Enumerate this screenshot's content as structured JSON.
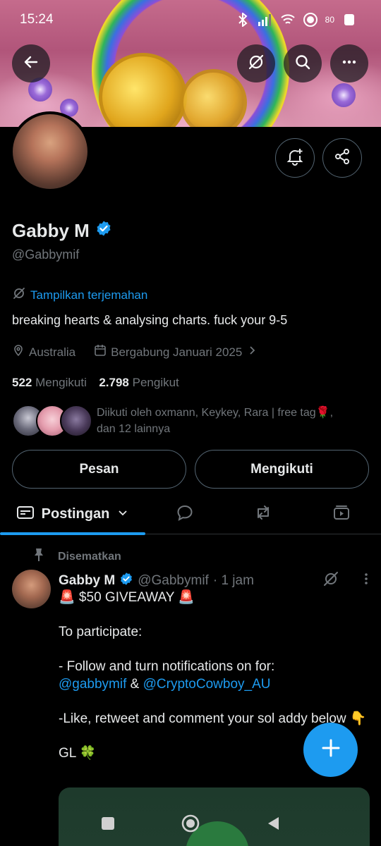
{
  "status_bar": {
    "time": "15:24",
    "battery": "80"
  },
  "colors": {
    "accent": "#1d9bf0",
    "muted": "#71767b",
    "text": "#e7e9ea",
    "border": "#536471",
    "background": "#000000"
  },
  "profile": {
    "name": "Gabby M",
    "handle": "@Gabbymif",
    "translate_label": "Tampilkan terjemahan",
    "bio": "breaking hearts & analysing charts. fuck your 9-5",
    "location": "Australia",
    "joined": "Bergabung Januari 2025",
    "following_count": "522",
    "following_label": "Mengikuti",
    "followers_count": "2.798",
    "followers_label": "Pengikut",
    "followed_by_line1": "Diikuti oleh oxmann, Keykey, Rara | free tag🌹,",
    "followed_by_line2": "dan 12 lainnya"
  },
  "actions": {
    "message_label": "Pesan",
    "following_label": "Mengikuti"
  },
  "tabs": {
    "posts_label": "Postingan"
  },
  "post": {
    "pinned_label": "Disematkan",
    "author_name": "Gabby M",
    "author_handle": "@Gabbymif",
    "time": "· 1 jam",
    "line1": "🚨 $50 GIVEAWAY 🚨",
    "line2": "To participate:",
    "line3": "- Follow and turn notifications on for:",
    "mention1": "@gabbymif",
    "amp": " & ",
    "mention2": "@CryptoCowboy_AU",
    "line5": "-Like, retweet and comment your sol addy below 👇",
    "line6": "GL 🍀"
  },
  "icons": [
    "back-arrow-icon",
    "translate-icon",
    "search-icon",
    "more-icon",
    "bell-plus-icon",
    "share-icon",
    "verified-badge-icon",
    "location-pin-icon",
    "calendar-icon",
    "chevron-right-icon",
    "chevron-down-icon",
    "reply-icon",
    "repost-icon",
    "media-icon",
    "pin-icon",
    "plus-icon"
  ]
}
